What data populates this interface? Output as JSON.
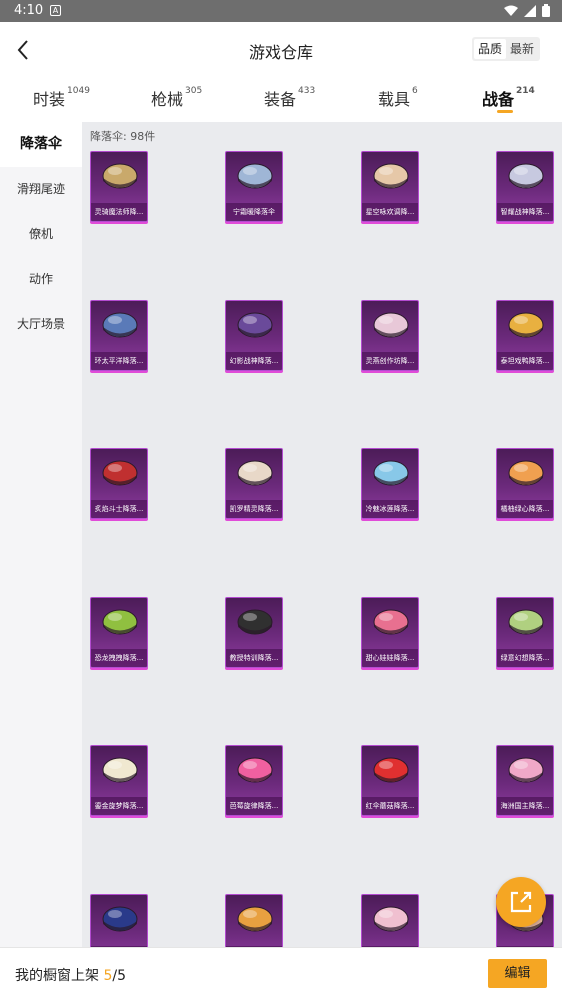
{
  "status": {
    "time": "4:10",
    "notif": "A"
  },
  "header": {
    "title": "游戏仓库",
    "sort_options": [
      "品质",
      "最新"
    ]
  },
  "tabs": [
    {
      "label": "时装",
      "count": "1049"
    },
    {
      "label": "枪械",
      "count": "305"
    },
    {
      "label": "装备",
      "count": "433"
    },
    {
      "label": "载具",
      "count": "6"
    },
    {
      "label": "战备",
      "count": "214"
    }
  ],
  "sidebar": {
    "items": [
      "降落伞",
      "滑翔尾迹",
      "僚机",
      "动作",
      "大厅场景"
    ]
  },
  "content": {
    "count_label": "降落伞: 98件",
    "items": [
      {
        "label": "灵骑魔法师降...",
        "color": "#c9a96b"
      },
      {
        "label": "宁霜暖降落伞",
        "color": "#9fb6d6"
      },
      {
        "label": "星空咏欢调降...",
        "color": "#e6c8a8"
      },
      {
        "label": "智耀战神降落...",
        "color": "#c7c9e0"
      },
      {
        "label": "环太平洋降落...",
        "color": "#5a7ab8"
      },
      {
        "label": "幻影战神降落...",
        "color": "#6a4a9a"
      },
      {
        "label": "灵燕创作坊降...",
        "color": "#e8c8d8"
      },
      {
        "label": "泰坦戏鸭降落...",
        "color": "#e8b040"
      },
      {
        "label": "炙焰斗士降落...",
        "color": "#c03030"
      },
      {
        "label": "凯罗精灵降落...",
        "color": "#e8d8c8"
      },
      {
        "label": "冷魅冰莲降落...",
        "color": "#88c8e8"
      },
      {
        "label": "橘柚绿心降落...",
        "color": "#f0a050"
      },
      {
        "label": "恐龙拽拽降落...",
        "color": "#90c040"
      },
      {
        "label": "教授特训降落...",
        "color": "#303030"
      },
      {
        "label": "甜心娃娃降落...",
        "color": "#e87090"
      },
      {
        "label": "绿意幻想降落...",
        "color": "#b0d080"
      },
      {
        "label": "鎏金旋梦降落...",
        "color": "#f0e8d0"
      },
      {
        "label": "芭莓旋律降落...",
        "color": "#f060a0"
      },
      {
        "label": "红伞蘑菇降落...",
        "color": "#e03030"
      },
      {
        "label": "海洲国主降落...",
        "color": "#f0a8c8"
      },
      {
        "label": "",
        "color": "#2a3a8a"
      },
      {
        "label": "",
        "color": "#e8a040"
      },
      {
        "label": "",
        "color": "#f0c0d0"
      },
      {
        "label": "",
        "color": "#e8b8a0"
      }
    ]
  },
  "footer": {
    "text_prefix": "我的橱窗上架 ",
    "current": "5",
    "sep": "/",
    "total": "5",
    "edit_label": "编辑"
  },
  "colors": {
    "accent": "#f5a623",
    "card_bg": "#6c2a7c",
    "card_border": "#e04bd8"
  },
  "icons": {
    "back": "chevron-left-icon",
    "fab": "share-external-icon"
  }
}
